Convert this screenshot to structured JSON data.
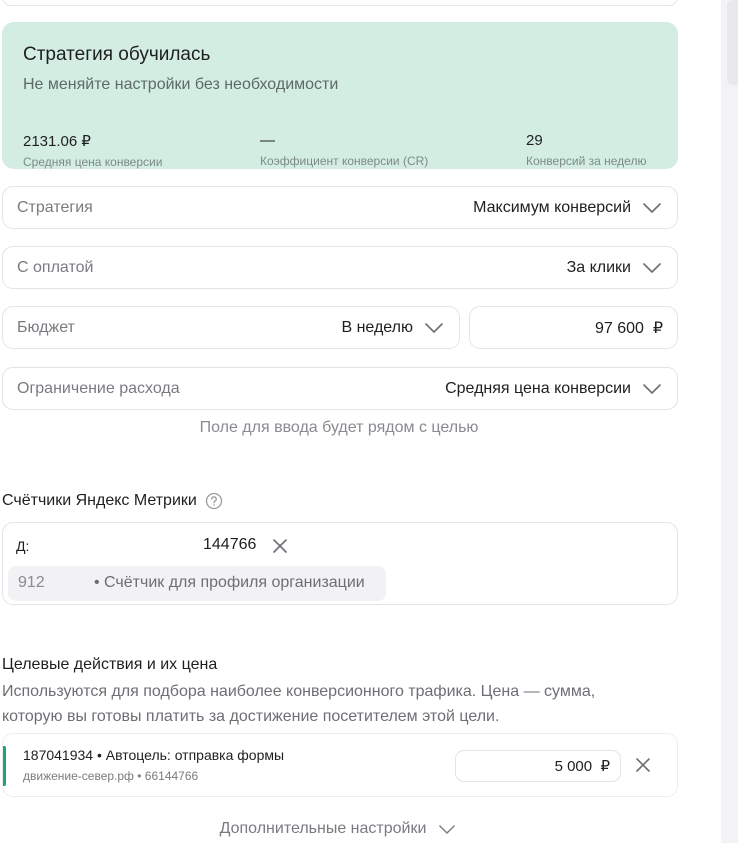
{
  "strategy_card": {
    "title": "Стратегия обучилась",
    "subtitle": "Не меняйте настройки без необходимости",
    "stats": [
      {
        "value": "2131.06 ₽",
        "label": "Средняя цена конверсии"
      },
      {
        "value": "—",
        "label": "Коэффициент конверсии (CR)"
      },
      {
        "value": "29",
        "label": "Конверсий за неделю"
      }
    ],
    "background": "#d3ede3"
  },
  "fields": {
    "strategy": {
      "label": "Стратегия",
      "value": "Максимум конверсий"
    },
    "payment": {
      "label": "С оплатой",
      "value": "За клики"
    },
    "budget": {
      "label": "Бюджет",
      "value": "В неделю"
    },
    "budget_amount": {
      "value": "97 600  ₽"
    },
    "spend_limit": {
      "label": "Ограничение расхода",
      "value": "Средняя цена конверсии"
    }
  },
  "hint": "Поле для ввода будет рядом с целью",
  "counters": {
    "title": "Счётчики Яндекс Метрики",
    "selected_prefix": "Д:",
    "selected_number": "144766",
    "suggestion_number": "912",
    "suggestion_desc": "• Счётчик для профиля организации"
  },
  "goals": {
    "title": "Целевые действия и их цена",
    "description": "Используются для подбора наиболее конверсионного трафика. Цена — сумма, которую вы готовы платить за достижение посетителем этой цели.",
    "items": [
      {
        "title": "187041934 • Автоцель: отправка формы",
        "subtitle": "движение-север.рф • 66144766",
        "price": "5 000  ₽"
      }
    ],
    "accent_color": "#1fa56b"
  },
  "more_settings": "Дополнительные настройки",
  "icons": {
    "chevron": "chevron-down-icon",
    "close": "close-icon",
    "help": "help-circle-icon"
  }
}
